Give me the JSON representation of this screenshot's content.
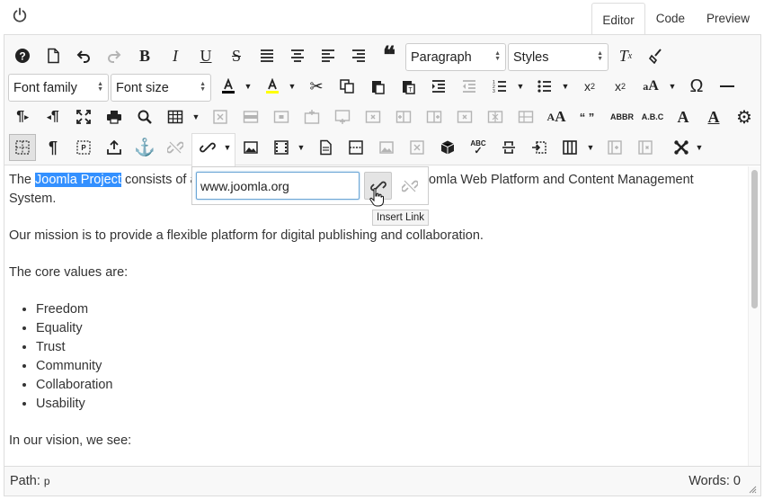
{
  "tabs": [
    {
      "label": "Editor",
      "active": true
    },
    {
      "label": "Code",
      "active": false
    },
    {
      "label": "Preview",
      "active": false
    }
  ],
  "toolbar": {
    "block_format": "Paragraph",
    "styles": "Styles",
    "font_family": "Font family",
    "font_size": "Font size",
    "abbr_label": "ABBR",
    "acronym_label": "A.B.C",
    "quotes_label": "“ ”",
    "spellcheck_label": "ABC",
    "font_color": "#000000",
    "highlight_color": "#ffff00"
  },
  "link_popup": {
    "url": "www.joomla.org",
    "tooltip": "Insert Link"
  },
  "content": {
    "p1_before": "The ",
    "p1_selected": "Joomla Project",
    "p1_after_a": " consists of a",
    "p1_hidden_tail": "e Joomla Web Platform and Content Management",
    "p1_line2": "System.",
    "p2": "Our mission is to provide a flexible platform for digital publishing and collaboration.",
    "p3": "The core values are:",
    "values": [
      "Freedom",
      "Equality",
      "Trust",
      "Community",
      "Collaboration",
      "Usability"
    ],
    "p4": "In our vision, we see:"
  },
  "status": {
    "path_label": "Path:",
    "path_value": "p",
    "words": "Words: 0"
  }
}
